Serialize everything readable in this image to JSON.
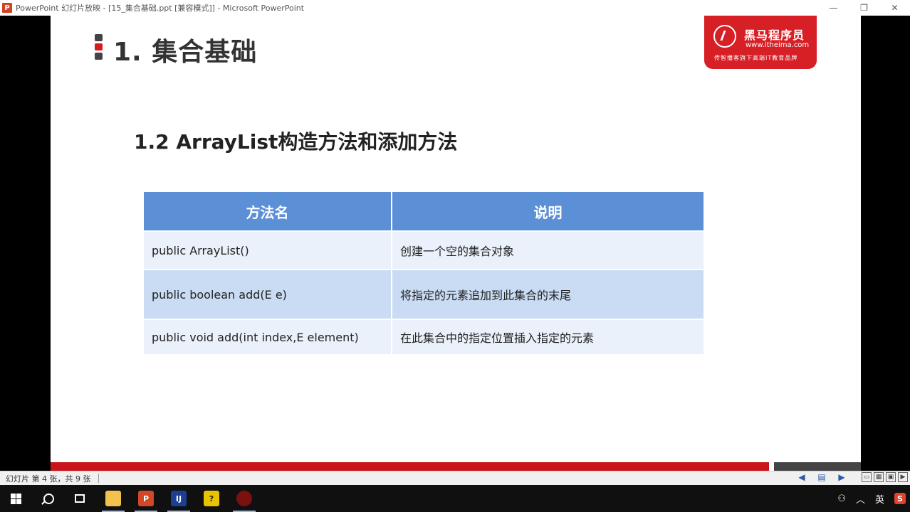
{
  "window": {
    "title": "PowerPoint 幻灯片放映 - [15_集合基础.ppt [兼容模式]] - Microsoft PowerPoint",
    "app_icon_letter": "P",
    "minimize_glyph": "—",
    "restore_glyph": "❐",
    "close_glyph": "✕"
  },
  "slide": {
    "title": "1. 集合基础",
    "subtitle": "1.2 ArrayList构造方法和添加方法",
    "logo": {
      "name": "黑马程序员",
      "url": "www.itheima.com",
      "slogan": "传智播客旗下高端IT教育品牌"
    },
    "table": {
      "headers": [
        "方法名",
        "说明"
      ],
      "rows": [
        {
          "method": "public ArrayList()",
          "desc": "创建一个空的集合对象"
        },
        {
          "method": "public boolean add(E e)",
          "desc": "将指定的元素追加到此集合的末尾"
        },
        {
          "method": "public void add(int index,E element)",
          "desc": "在此集合中的指定位置插入指定的元素"
        }
      ]
    }
  },
  "statusbar": {
    "slide_info": "幻灯片 第 4 张，共 9 张"
  },
  "taskbar": {
    "ime_label": "英",
    "sogou_label": "S",
    "ppt_label": "P",
    "idea_label": "IJ",
    "help_label": "?"
  },
  "colors": {
    "header_blue": "#5b8fd6",
    "row_light": "#eaf1fa",
    "row_mid": "#c9dcf3",
    "brand_red": "#d62026"
  }
}
